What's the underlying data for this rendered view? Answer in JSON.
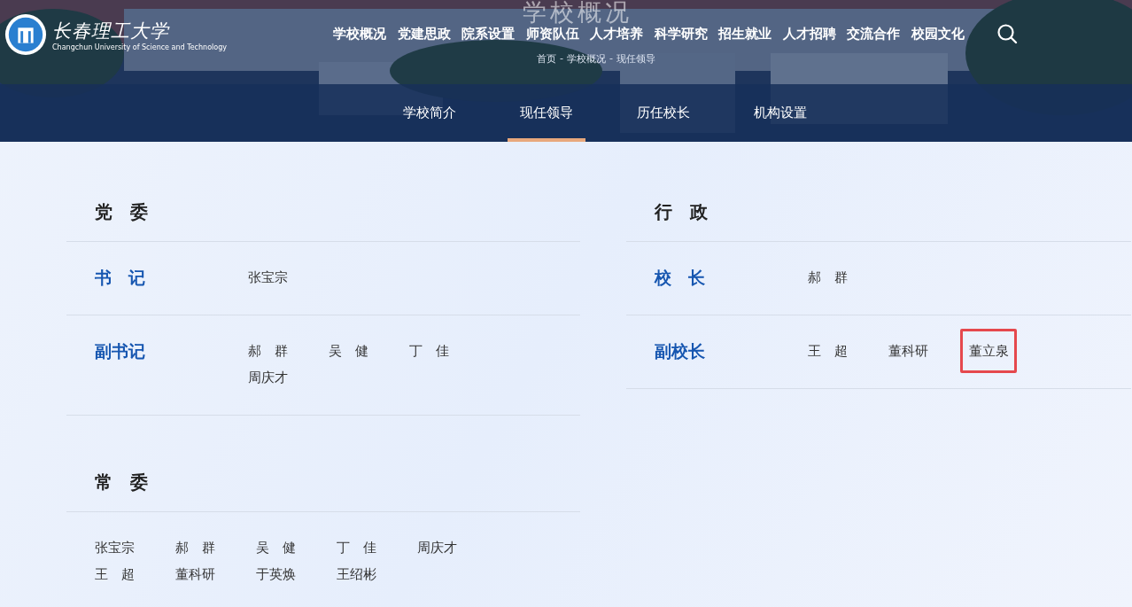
{
  "header": {
    "logo_name": "长春理工大学",
    "logo_subtitle": "Changchun University of Science and Technology",
    "page_title": "学校概况",
    "nav": [
      "学校概况",
      "党建思政",
      "院系设置",
      "师资队伍",
      "人才培养",
      "科学研究",
      "招生就业",
      "人才招聘",
      "交流合作",
      "校园文化"
    ],
    "breadcrumb": [
      {
        "label": "首页",
        "separator": "-"
      },
      {
        "label": "学校概况",
        "separator": "-"
      },
      {
        "label": "现任领导"
      }
    ]
  },
  "tabs": [
    {
      "label": "学校简介",
      "selected": false
    },
    {
      "label": "现任领导",
      "selected": true
    },
    {
      "label": "历任校长",
      "selected": false
    },
    {
      "label": "机构设置",
      "selected": false
    }
  ],
  "columns": [
    {
      "sections": [
        {
          "heading": "党　委",
          "rows": [
            {
              "title": "书　记",
              "names": [
                {
                  "name": "张宝宗",
                  "highlighted": false
                }
              ]
            },
            {
              "title": "副书记",
              "names": [
                {
                  "name": "郝　群",
                  "highlighted": false
                },
                {
                  "name": "吴　健",
                  "highlighted": false
                },
                {
                  "name": "丁　佳",
                  "highlighted": false
                },
                {
                  "name": "周庆才",
                  "highlighted": false
                }
              ]
            }
          ]
        },
        {
          "heading": "常　委",
          "rows": [
            {
              "names": [
                {
                  "name": "张宝宗",
                  "highlighted": false
                },
                {
                  "name": "郝　群",
                  "highlighted": false
                },
                {
                  "name": "吴　健",
                  "highlighted": false
                },
                {
                  "name": "丁　佳",
                  "highlighted": false
                },
                {
                  "name": "周庆才",
                  "highlighted": false
                },
                {
                  "name": "王　超",
                  "highlighted": false
                },
                {
                  "name": "董科研",
                  "highlighted": false
                },
                {
                  "name": "于英焕",
                  "highlighted": false
                },
                {
                  "name": "王绍彬",
                  "highlighted": false
                }
              ]
            }
          ]
        }
      ]
    },
    {
      "sections": [
        {
          "heading": "行　政",
          "rows": [
            {
              "title": "校　长",
              "names": [
                {
                  "name": "郝　群",
                  "highlighted": false
                }
              ]
            },
            {
              "title": "副校长",
              "names": [
                {
                  "name": "王　超",
                  "highlighted": false
                },
                {
                  "name": "董科研",
                  "highlighted": false
                },
                {
                  "name": "董立泉",
                  "highlighted": true
                }
              ]
            }
          ]
        }
      ]
    }
  ]
}
